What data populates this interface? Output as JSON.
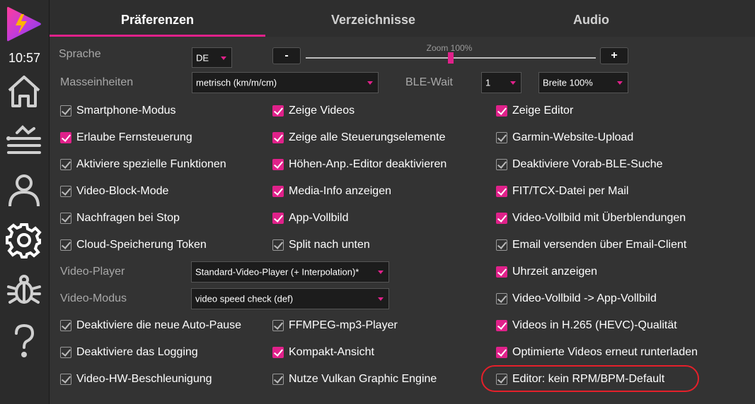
{
  "sidebar": {
    "time": "10:57",
    "icons": [
      "home-icon",
      "activities-icon",
      "user-icon",
      "settings-icon",
      "bug-icon",
      "help-icon"
    ]
  },
  "tabs": [
    {
      "label": "Präferenzen",
      "active": true
    },
    {
      "label": "Verzeichnisse",
      "active": false
    },
    {
      "label": "Audio",
      "active": false
    }
  ],
  "settings": {
    "sprache_label": "Sprache",
    "sprache_value": "DE",
    "zoom_label": "Zoom 100%",
    "zoom_minus": "-",
    "zoom_plus": "+",
    "zoom_fraction": 0.5,
    "masseinheiten_label": "Masseinheiten",
    "masseinheiten_value": "metrisch (km/m/cm)",
    "ble_wait_label": "BLE-Wait",
    "ble_wait_value": "1",
    "breite_value": "Breite 100%",
    "video_player_label": "Video-Player",
    "video_player_value": "Standard-Video-Player (+ Interpolation)*",
    "video_modus_label": "Video-Modus",
    "video_modus_value": "video speed check (def)"
  },
  "checkboxes": {
    "col1": [
      {
        "label": "Smartphone-Modus",
        "checked": false
      },
      {
        "label": "Erlaube Fernsteuerung",
        "checked": true
      },
      {
        "label": "Aktiviere spezielle Funktionen",
        "checked": false
      },
      {
        "label": "Video-Block-Mode",
        "checked": false
      },
      {
        "label": "Nachfragen bei Stop",
        "checked": false
      },
      {
        "label": "Cloud-Speicherung Token",
        "checked": false
      },
      {
        "label": "Deaktiviere die neue Auto-Pause",
        "checked": false
      },
      {
        "label": "Deaktiviere das Logging",
        "checked": false
      },
      {
        "label": "Video-HW-Beschleunigung",
        "checked": false
      }
    ],
    "col2": [
      {
        "label": "Zeige Videos",
        "checked": true
      },
      {
        "label": "Zeige alle Steuerungselemente",
        "checked": true
      },
      {
        "label": "Höhen-Anp.-Editor deaktivieren",
        "checked": true
      },
      {
        "label": "Media-Info anzeigen",
        "checked": true
      },
      {
        "label": "App-Vollbild",
        "checked": true
      },
      {
        "label": "Split nach unten",
        "checked": false
      },
      {
        "label": "FFMPEG-mp3-Player",
        "checked": false
      },
      {
        "label": "Kompakt-Ansicht",
        "checked": true
      },
      {
        "label": "Nutze Vulkan Graphic Engine",
        "checked": false
      }
    ],
    "col3": [
      {
        "label": "Zeige Editor",
        "checked": true
      },
      {
        "label": "Garmin-Website-Upload",
        "checked": false
      },
      {
        "label": "Deaktiviere Vorab-BLE-Suche",
        "checked": false
      },
      {
        "label": "FIT/TCX-Datei per Mail",
        "checked": true
      },
      {
        "label": "Video-Vollbild mit Überblendungen",
        "checked": true
      },
      {
        "label": "Email versenden über Email-Client",
        "checked": false
      },
      {
        "label": "Uhrzeit anzeigen",
        "checked": true
      },
      {
        "label": "Video-Vollbild -> App-Vollbild",
        "checked": false
      },
      {
        "label": "Videos in H.265 (HEVC)-Qualität",
        "checked": true
      },
      {
        "label": "Optimierte Videos erneut runterladen",
        "checked": true
      },
      {
        "label": "Editor: kein RPM/BPM-Default",
        "checked": false
      }
    ]
  },
  "colors": {
    "accent": "#e0218a",
    "highlight": "#e4202a"
  }
}
